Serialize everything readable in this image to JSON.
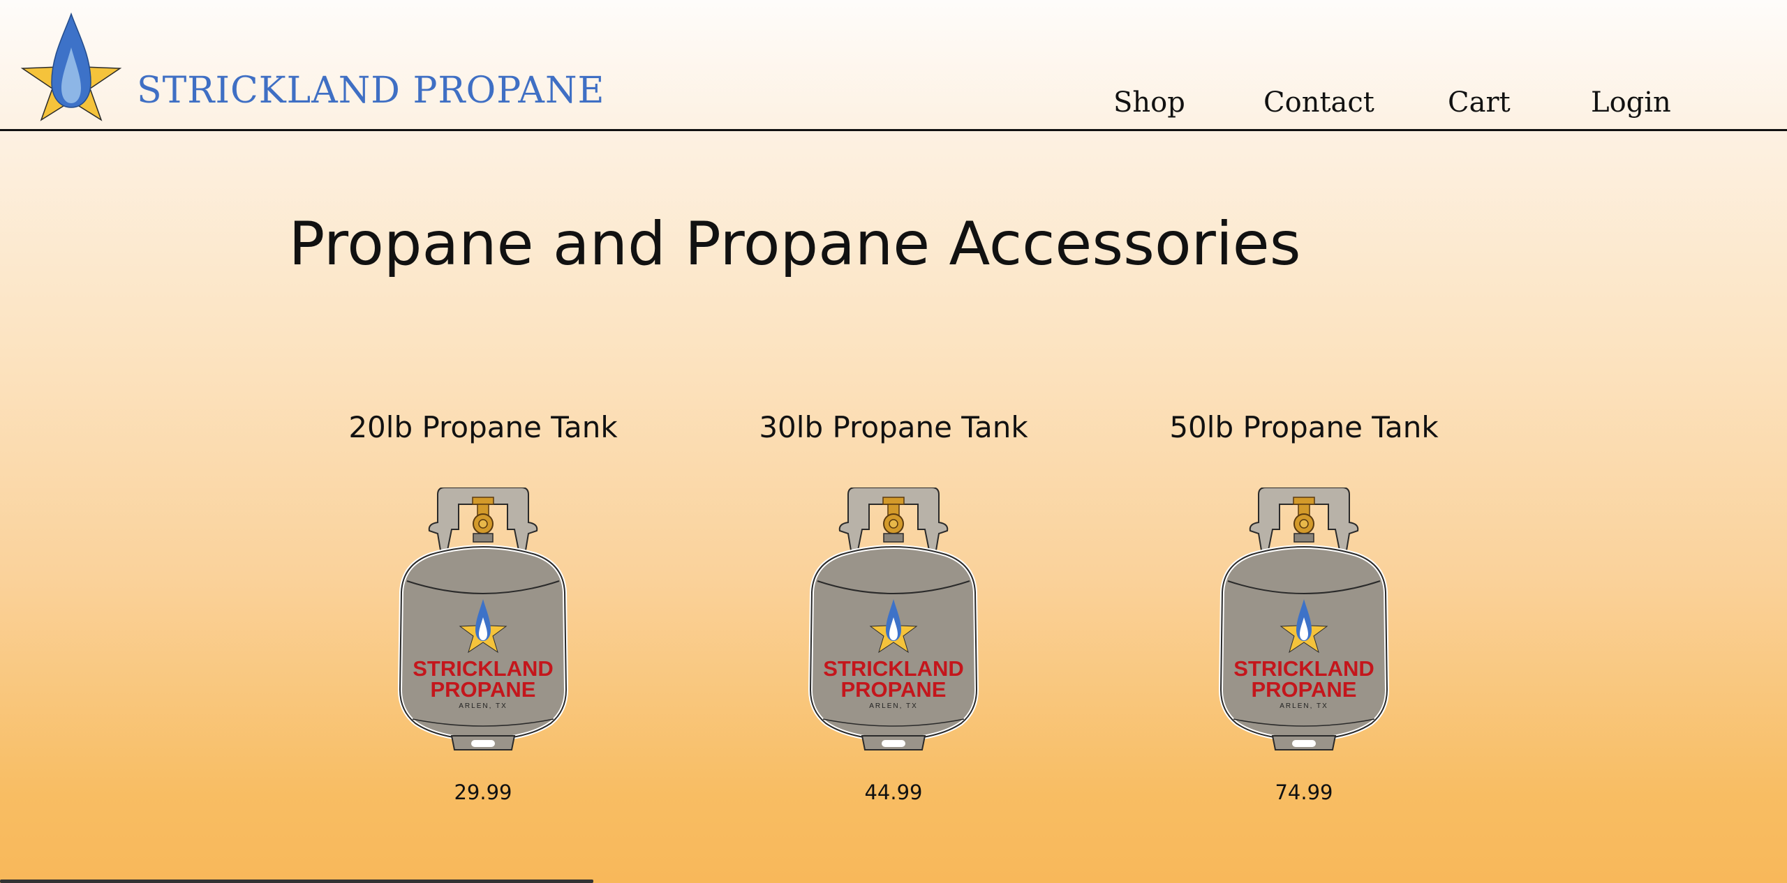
{
  "header": {
    "brand": "STRICKLAND PROPANE",
    "nav": {
      "shop": "Shop",
      "contact": "Contact",
      "cart": "Cart",
      "login": "Login"
    }
  },
  "main": {
    "title": "Propane and Propane Accessories",
    "products": [
      {
        "name": "20lb Propane Tank",
        "price": "29.99",
        "tank_brand_line1": "STRICKLAND",
        "tank_brand_line2": "PROPANE",
        "tank_location": "ARLEN, TX"
      },
      {
        "name": "30lb Propane Tank",
        "price": "44.99",
        "tank_brand_line1": "STRICKLAND",
        "tank_brand_line2": "PROPANE",
        "tank_location": "ARLEN, TX"
      },
      {
        "name": "50lb Propane Tank",
        "price": "74.99",
        "tank_brand_line1": "STRICKLAND",
        "tank_brand_line2": "PROPANE",
        "tank_location": "ARLEN, TX"
      }
    ]
  },
  "colors": {
    "brand_blue": "#3f6fc4",
    "star_yellow": "#f5c33b",
    "tank_gray": "#9a948a",
    "brand_red": "#c4161c",
    "valve_brass": "#d39a2a"
  },
  "icons": {
    "logo": "star-flame-icon",
    "product_image": "propane-tank-icon"
  }
}
